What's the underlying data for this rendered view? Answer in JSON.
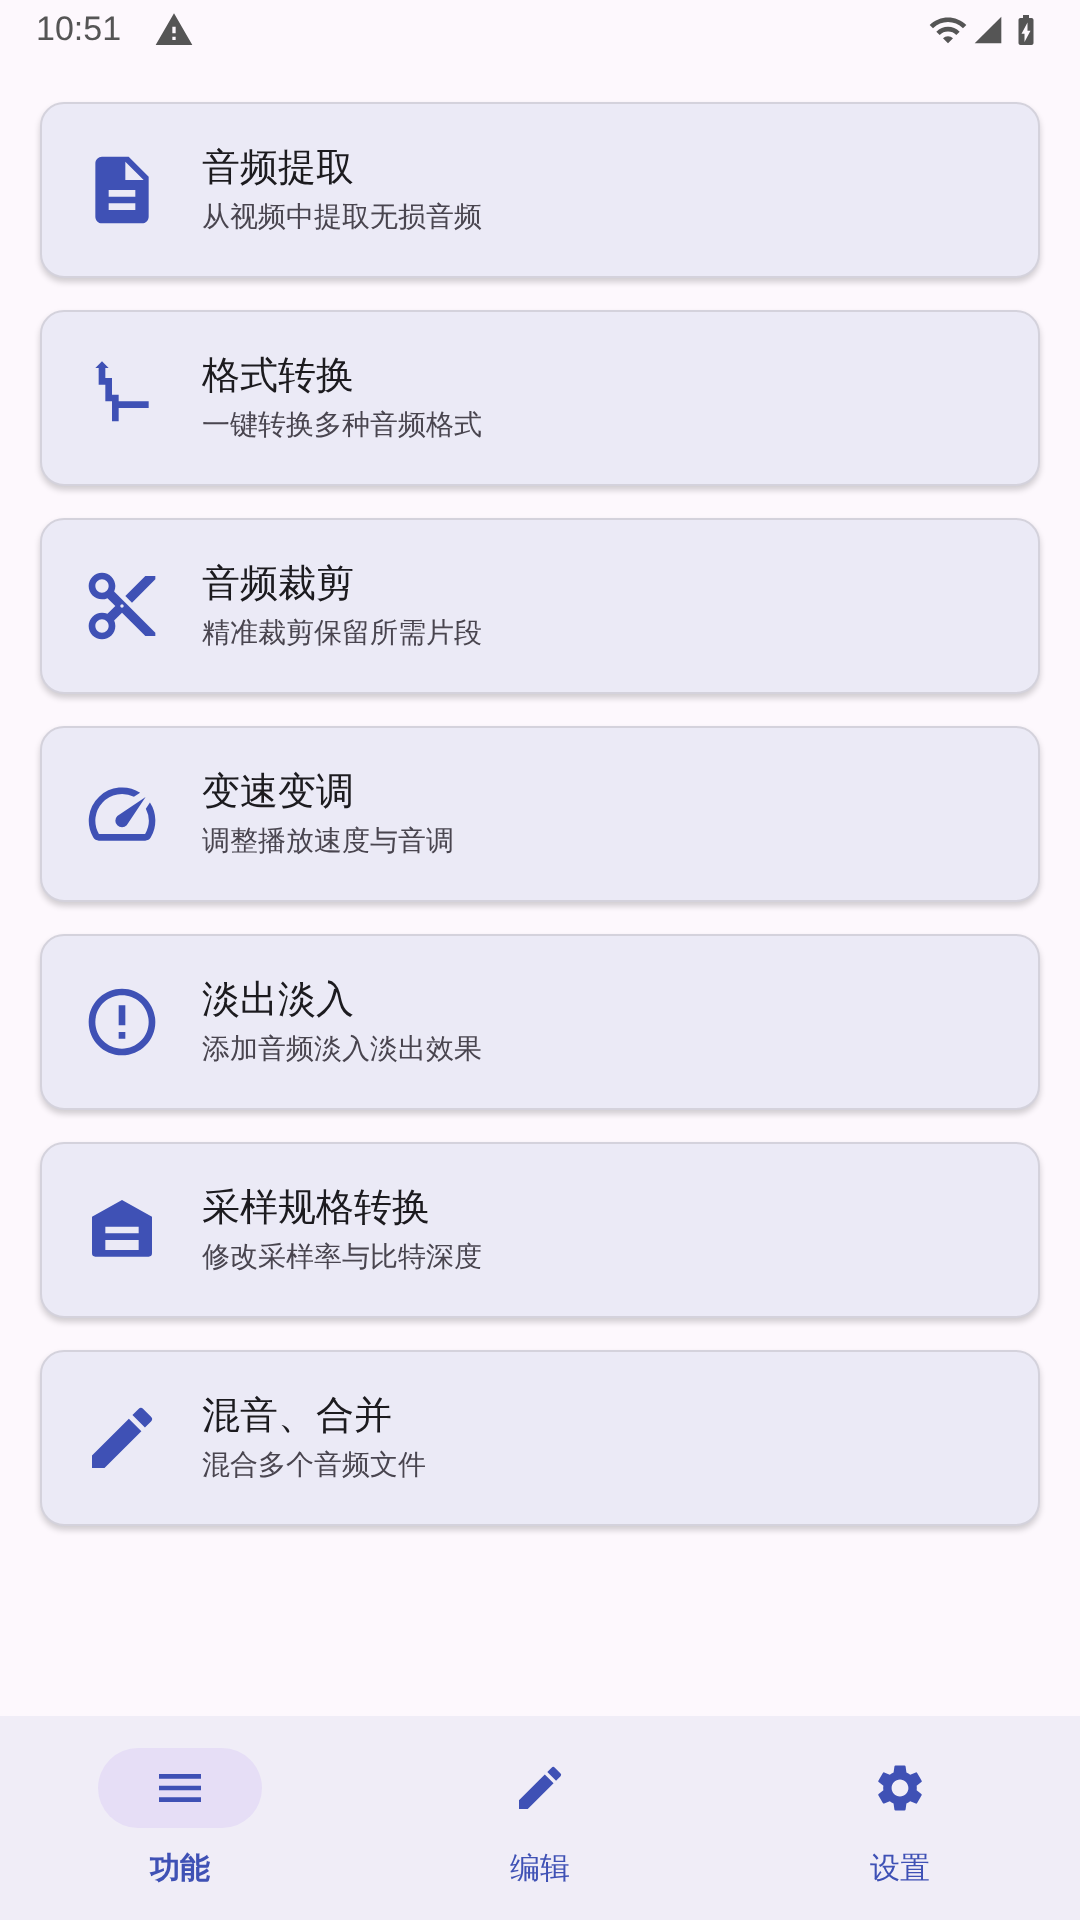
{
  "status_bar": {
    "time": "10:51"
  },
  "features": [
    {
      "title": "音频提取",
      "subtitle": "从视频中提取无损音频"
    },
    {
      "title": "格式转换",
      "subtitle": "一键转换多种音频格式"
    },
    {
      "title": "音频裁剪",
      "subtitle": "精准裁剪保留所需片段"
    },
    {
      "title": "变速变调",
      "subtitle": "调整播放速度与音调"
    },
    {
      "title": "淡出淡入",
      "subtitle": "添加音频淡入淡出效果"
    },
    {
      "title": "采样规格转换",
      "subtitle": "修改采样率与比特深度"
    },
    {
      "title": "混音、合并",
      "subtitle": "混合多个音频文件"
    }
  ],
  "bottom_nav": [
    {
      "label": "功能",
      "selected": true
    },
    {
      "label": "编辑",
      "selected": false
    },
    {
      "label": "设置",
      "selected": false
    }
  ]
}
